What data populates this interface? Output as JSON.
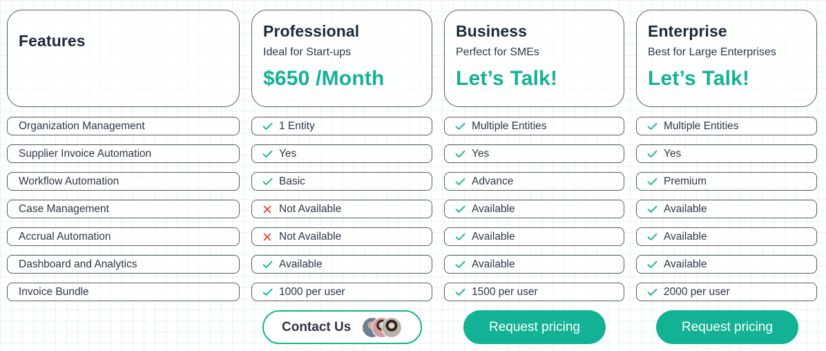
{
  "colors": {
    "accent": "#13b294",
    "check": "#13b294",
    "cross": "#e53935",
    "text_dark": "#1e293b",
    "border": "#555b61"
  },
  "features": {
    "title": "Features",
    "items": [
      "Organization Management",
      "Supplier Invoice Automation",
      "Workflow Automation",
      "Case Management",
      "Accrual Automation",
      "Dashboard and Analytics",
      "Invoice Bundle"
    ]
  },
  "plans": [
    {
      "name": "Professional",
      "tagline": "Ideal for Start-ups",
      "price": "$650 /Month",
      "values": [
        {
          "icon": "check-icon",
          "text": "1 Entity"
        },
        {
          "icon": "check-icon",
          "text": "Yes"
        },
        {
          "icon": "check-icon",
          "text": "Basic"
        },
        {
          "icon": "cross-icon",
          "text": "Not Available"
        },
        {
          "icon": "cross-icon",
          "text": "Not Available"
        },
        {
          "icon": "check-icon",
          "text": "Available"
        },
        {
          "icon": "check-icon",
          "text": "1000 per user"
        }
      ],
      "cta": "Contact Us"
    },
    {
      "name": "Business",
      "tagline": "Perfect for SMEs",
      "price": "Let’s Talk!",
      "values": [
        {
          "icon": "check-icon",
          "text": "Multiple Entities"
        },
        {
          "icon": "check-icon",
          "text": "Yes"
        },
        {
          "icon": "check-icon",
          "text": "Advance"
        },
        {
          "icon": "check-icon",
          "text": "Available"
        },
        {
          "icon": "check-icon",
          "text": "Available"
        },
        {
          "icon": "check-icon",
          "text": "Available"
        },
        {
          "icon": "check-icon",
          "text": "1500 per user"
        }
      ],
      "cta": "Request pricing"
    },
    {
      "name": "Enterprise",
      "tagline": "Best for Large Enterprises",
      "price": "Let’s Talk!",
      "values": [
        {
          "icon": "check-icon",
          "text": "Multiple Entities"
        },
        {
          "icon": "check-icon",
          "text": "Yes"
        },
        {
          "icon": "check-icon",
          "text": "Premium"
        },
        {
          "icon": "check-icon",
          "text": "Available"
        },
        {
          "icon": "check-icon",
          "text": "Available"
        },
        {
          "icon": "check-icon",
          "text": "Available"
        },
        {
          "icon": "check-icon",
          "text": "2000 per user"
        }
      ],
      "cta": "Request pricing"
    }
  ]
}
